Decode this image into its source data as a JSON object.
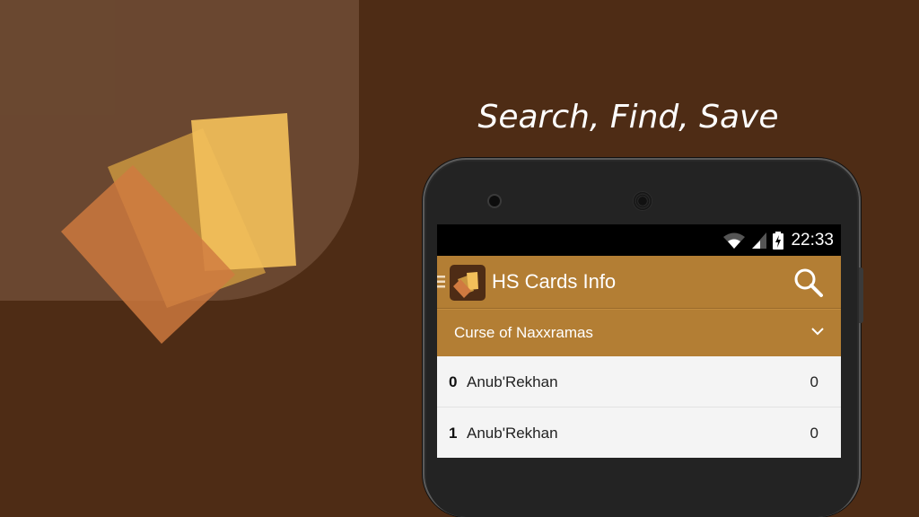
{
  "banner": {
    "tagline": "Search, Find, Save"
  },
  "status_bar": {
    "time": "22:33"
  },
  "action_bar": {
    "title": "HS Cards Info"
  },
  "set_selector": {
    "selected": "Curse of Naxxramas"
  },
  "cards": [
    {
      "cost": "0",
      "name": "Anub'Rekhan",
      "count": "0"
    },
    {
      "cost": "1",
      "name": "Anub'Rekhan",
      "count": "0"
    }
  ],
  "colors": {
    "background": "#4e2c15",
    "action_bar": "#b37e34",
    "card_light": "#f2bf5a",
    "card_mid": "#c9963f",
    "card_dark": "#d07a40"
  },
  "icons": {
    "drawer": "drawer-icon",
    "app": "app-logo-icon",
    "search": "search-icon",
    "dropdown": "chevron-down-icon",
    "wifi": "wifi-icon",
    "signal": "signal-icon",
    "battery": "battery-icon"
  }
}
